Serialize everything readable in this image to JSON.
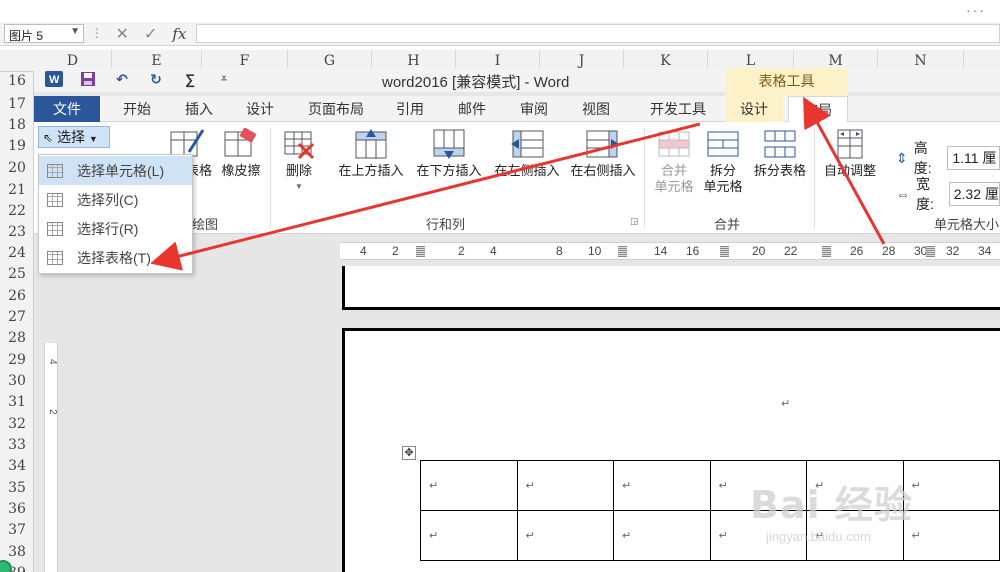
{
  "excel": {
    "namebox": "图片 5",
    "fx_label": "fx",
    "columns": [
      "D",
      "E",
      "F",
      "G",
      "H",
      "I",
      "J",
      "K",
      "L",
      "M",
      "N"
    ],
    "rows": [
      "16",
      "17",
      "18",
      "19",
      "20",
      "21",
      "22",
      "23",
      "24",
      "25",
      "26",
      "27",
      "28",
      "29",
      "30",
      "31",
      "32",
      "33",
      "34",
      "35",
      "36",
      "37",
      "38",
      "39"
    ]
  },
  "word": {
    "title": "word2016 [兼容模式] - Word",
    "context_title": "表格工具",
    "tabs": {
      "file": "文件",
      "home": "开始",
      "insert": "插入",
      "design": "设计",
      "layout_page": "页面布局",
      "references": "引用",
      "mailings": "邮件",
      "review": "审阅",
      "view": "视图",
      "developer": "开发工具",
      "table_design": "设计",
      "table_layout": "布局"
    },
    "ribbon": {
      "select_label": "选择",
      "draw_table_partial": "表格",
      "eraser": "橡皮擦",
      "draw_group": "绘图",
      "delete": "删除",
      "insert_above": "在上方插入",
      "insert_below": "在下方插入",
      "insert_left": "在左侧插入",
      "insert_right": "在右侧插入",
      "rows_cols_group": "行和列",
      "merge_cells_1": "合并",
      "merge_cells_2": "单元格",
      "split_cells_1": "拆分",
      "split_cells_2": "单元格",
      "split_table": "拆分表格",
      "merge_group": "合并",
      "autofit": "自动调整",
      "height_label": "高度:",
      "height_value": "1.11 厘",
      "width_label": "宽度:",
      "width_value": "2.32 厘",
      "cell_size_group": "单元格大小"
    },
    "select_menu": [
      "选择单元格(L)",
      "选择列(C)",
      "选择行(R)",
      "选择表格(T)"
    ],
    "ruler_numbers": [
      "4",
      "2",
      "2",
      "4",
      "8",
      "10",
      "14",
      "16",
      "20",
      "22",
      "26",
      "28",
      "30",
      "32",
      "34"
    ],
    "vruler_numbers": [
      "4",
      "2"
    ],
    "para_mark": "↵"
  },
  "watermark": {
    "main": "Bai 经验",
    "sub": "jingyan.baidu.com"
  },
  "colors": {
    "file_tab": "#2b579a",
    "context_tab": "#fdf1c8",
    "arrow": "#e8352e",
    "highlight": "#cfe3f7"
  }
}
